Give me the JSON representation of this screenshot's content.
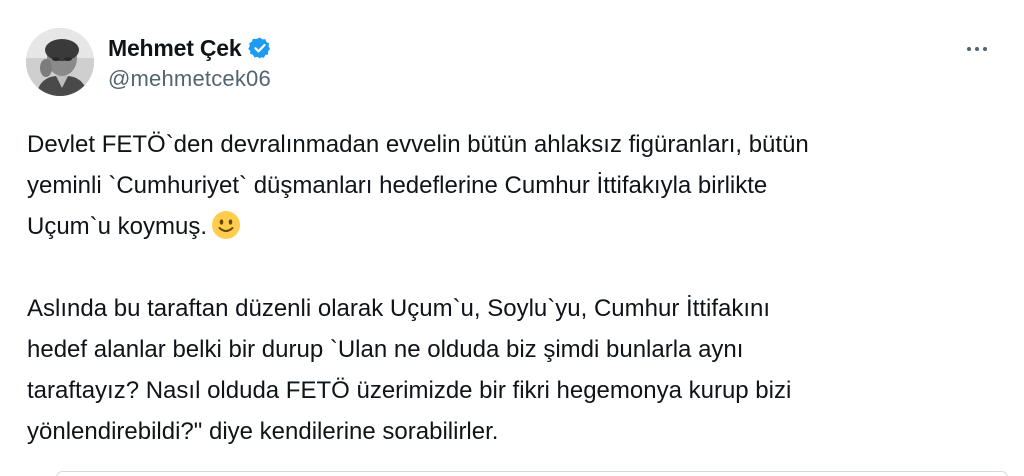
{
  "tweet": {
    "author": {
      "display_name": "Mehmet Çek",
      "handle": "@mehmetcek06",
      "verified": true,
      "avatar_icon": "profile-photo",
      "verified_color": "#1d9bf0"
    },
    "more_icon": "ellipsis-icon",
    "text": {
      "paragraph1": [
        "Devlet FETÖ`den devralınmadan evvelin bütün ahlaksız figüranları, bütün",
        "yeminli `Cumhuriyet` düşmanları hedeflerine Cumhur İttifakıyla birlikte",
        "Uçum`u koymuş."
      ],
      "paragraph1_emoji": "slightly-smiling-face-emoji",
      "paragraph2": [
        "Aslında bu taraftan düzenli olarak Uçum`u, Soylu`yu, Cumhur İttifakını",
        "hedef alanlar belki bir durup `Ulan ne olduda biz şimdi bunlarla aynı",
        "taraftayız? Nasıl olduda FETÖ üzerimizde bir fikri hegemonya kurup bizi",
        "yönlendirebildi?\" diye kendilerine sorabilirler."
      ]
    }
  }
}
